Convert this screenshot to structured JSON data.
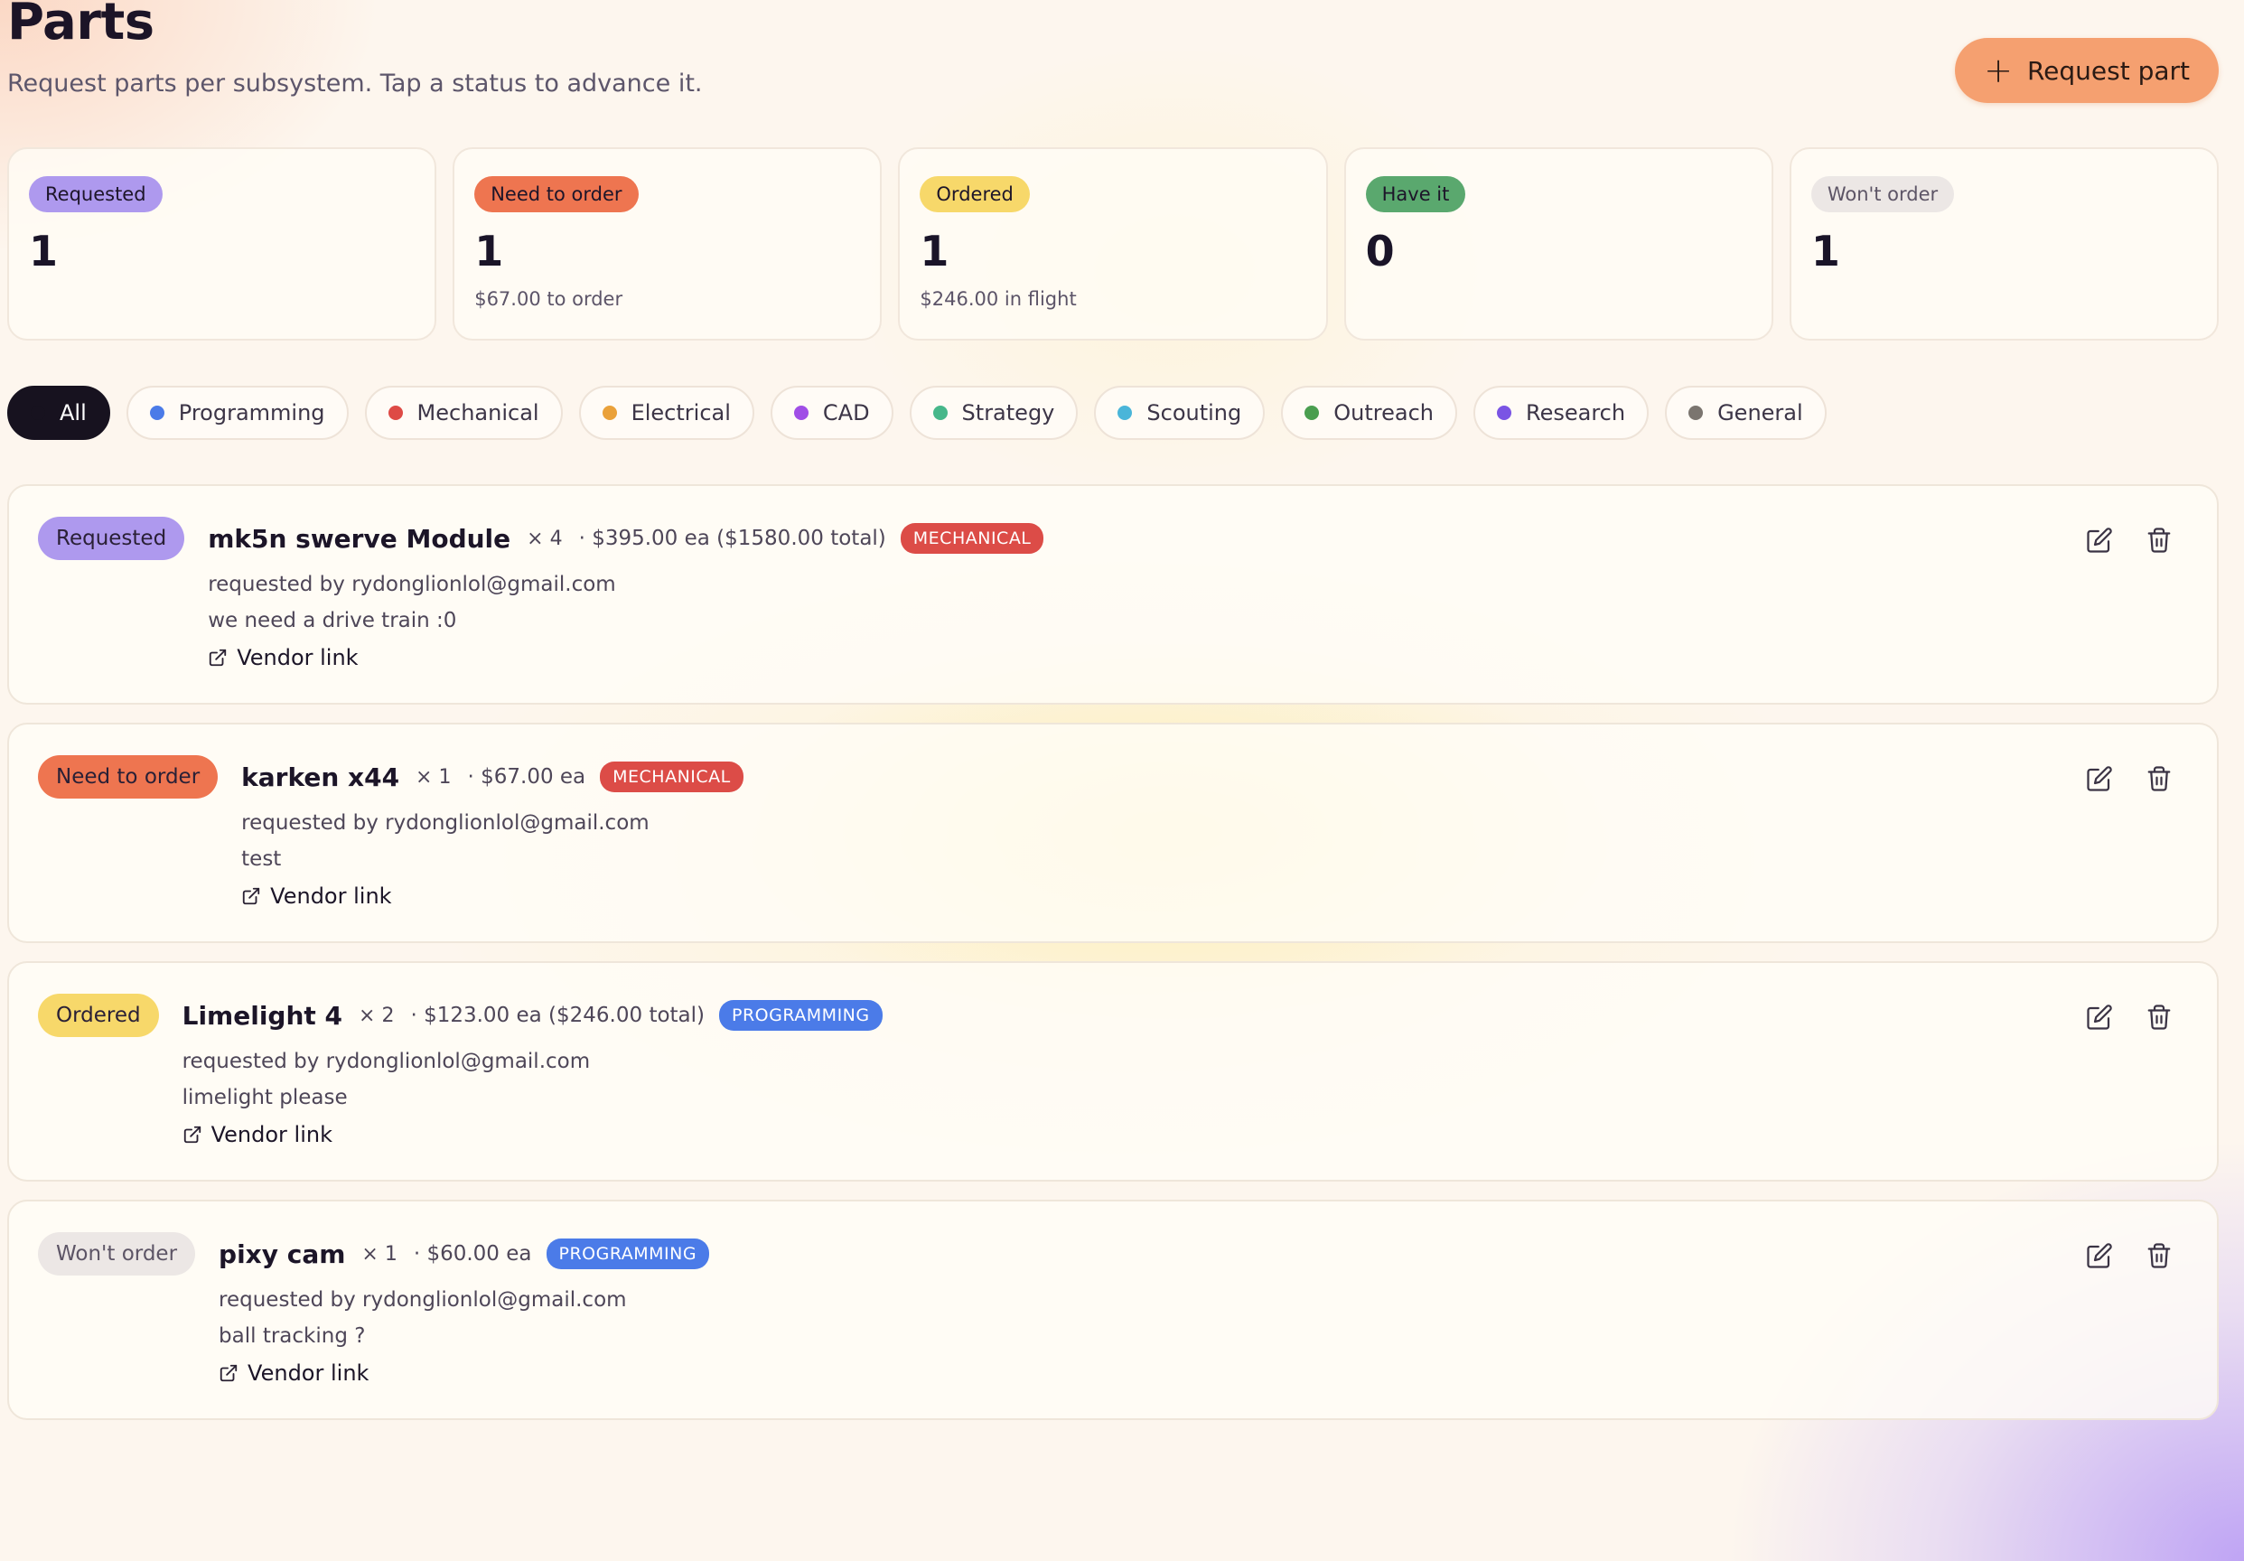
{
  "header": {
    "title": "Parts",
    "subtitle": "Request parts per subsystem. Tap a status to advance it.",
    "request_button": "Request part"
  },
  "stats": [
    {
      "label": "Requested",
      "count": "1",
      "note": "",
      "color": "#ae99ee"
    },
    {
      "label": "Need to order",
      "count": "1",
      "note": "$67.00 to order",
      "color": "#ee7550"
    },
    {
      "label": "Ordered",
      "count": "1",
      "note": "$246.00 in flight",
      "color": "#f7d86a"
    },
    {
      "label": "Have it",
      "count": "0",
      "note": "",
      "color": "#5aa86e"
    },
    {
      "label": "Won't order",
      "count": "1",
      "note": "",
      "color": "#ece7e5"
    }
  ],
  "filters": [
    {
      "label": "All",
      "color": "#17121f"
    },
    {
      "label": "Programming",
      "color": "#4b7be8"
    },
    {
      "label": "Mechanical",
      "color": "#de4a45"
    },
    {
      "label": "Electrical",
      "color": "#eaa13a"
    },
    {
      "label": "CAD",
      "color": "#a04ee6"
    },
    {
      "label": "Strategy",
      "color": "#46b78a"
    },
    {
      "label": "Scouting",
      "color": "#4ab5d9"
    },
    {
      "label": "Outreach",
      "color": "#4a9e4f"
    },
    {
      "label": "Research",
      "color": "#7a54e4"
    },
    {
      "label": "General",
      "color": "#7b756f"
    }
  ],
  "parts": [
    {
      "status": "Requested",
      "status_color": "#ae99ee",
      "name": "mk5n swerve Module",
      "qty": "× 4",
      "price": "· $395.00 ea ($1580.00 total)",
      "tag": "MECHANICAL",
      "tag_color": "#dc4c47",
      "requester": "requested by rydonglionlol@gmail.com",
      "note": "we need a drive train :0",
      "link": "Vendor link"
    },
    {
      "status": "Need to order",
      "status_color": "#ee7550",
      "name": "karken x44",
      "qty": "× 1",
      "price": "· $67.00 ea",
      "tag": "MECHANICAL",
      "tag_color": "#dc4c47",
      "requester": "requested by rydonglionlol@gmail.com",
      "note": "test",
      "link": "Vendor link"
    },
    {
      "status": "Ordered",
      "status_color": "#f7d86a",
      "name": "Limelight 4",
      "qty": "× 2",
      "price": "· $123.00 ea ($246.00 total)",
      "tag": "PROGRAMMING",
      "tag_color": "#4b7be8",
      "requester": "requested by rydonglionlol@gmail.com",
      "note": "limelight please",
      "link": "Vendor link"
    },
    {
      "status": "Won't order",
      "status_color": "#ece7e5",
      "name": "pixy cam",
      "qty": "× 1",
      "price": "· $60.00 ea",
      "tag": "PROGRAMMING",
      "tag_color": "#4b7be8",
      "requester": "requested by rydonglionlol@gmail.com",
      "note": "ball tracking ?",
      "link": "Vendor link"
    }
  ]
}
